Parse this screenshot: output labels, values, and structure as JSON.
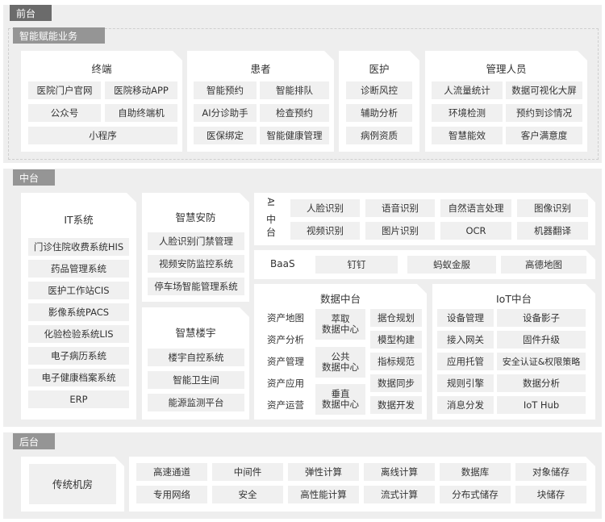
{
  "layers": {
    "front": "前台",
    "middle": "中台",
    "back": "后台"
  },
  "front": {
    "group_label": "智能赋能业务",
    "terminal": {
      "title": "终端",
      "items": [
        "医院门户官网",
        "医院移动APP",
        "公众号",
        "自助终端机",
        "小程序"
      ]
    },
    "patient": {
      "title": "患者",
      "items": [
        "智能预约",
        "智能排队",
        "AI分诊助手",
        "检查预约",
        "医保绑定",
        "智能健康管理"
      ]
    },
    "medical": {
      "title": "医护",
      "items": [
        "诊断风控",
        "辅助分析",
        "病例资质"
      ]
    },
    "admin": {
      "title": "管理人员",
      "items": [
        "人流量统计",
        "数据可视化大屏",
        "环境检测",
        "预约到诊情况",
        "智慧能效",
        "客户满意度"
      ]
    }
  },
  "middle": {
    "it": {
      "title": "IT系统",
      "items": [
        "门诊住院收费系统HIS",
        "药品管理系统",
        "医护工作站CIS",
        "影像系统PACS",
        "化验检验系统LIS",
        "电子病历系统",
        "电子健康档案系统",
        "ERP"
      ]
    },
    "security": {
      "title": "智慧安防",
      "items": [
        "人脸识别门禁管理",
        "视频安防监控系统",
        "停车场智能管理系统"
      ]
    },
    "building": {
      "title": "智慧楼宇",
      "items": [
        "楼宇自控系统",
        "智能卫生间",
        "能源监测平台"
      ]
    },
    "ai": {
      "label_lines": [
        "AI",
        "中",
        "台"
      ],
      "items": [
        "人脸识别",
        "语音识别",
        "自然语言处理",
        "图像识别",
        "视频识别",
        "图片识别",
        "OCR",
        "机器翻译"
      ]
    },
    "baas": {
      "label": "BaaS",
      "items": [
        "钉钉",
        "蚂蚁金服",
        "高德地图"
      ]
    },
    "data": {
      "title": "数据中台",
      "left": [
        "资产地图",
        "资产分析",
        "资产管理",
        "资产应用",
        "资产运营"
      ],
      "center": [
        "萃取\n数据中心",
        "公共\n数据中心",
        "垂直\n数据中心"
      ],
      "right": [
        "据仓规划",
        "模型构建",
        "指标规范",
        "数据同步",
        "数据开发"
      ]
    },
    "iot": {
      "title": "IoT中台",
      "items": [
        "设备管理",
        "设备影子",
        "接入网关",
        "固件升级",
        "应用托管",
        "安全认证&权限策略",
        "规则引擎",
        "数据分析",
        "消息分发",
        "IoT Hub"
      ]
    }
  },
  "back": {
    "legacy": "传统机房",
    "items": [
      "高速通道",
      "中间件",
      "弹性计算",
      "离线计算",
      "数据库",
      "对象储存",
      "专用网络",
      "安全",
      "高性能计算",
      "流式计算",
      "分布式储存",
      "块储存"
    ]
  }
}
